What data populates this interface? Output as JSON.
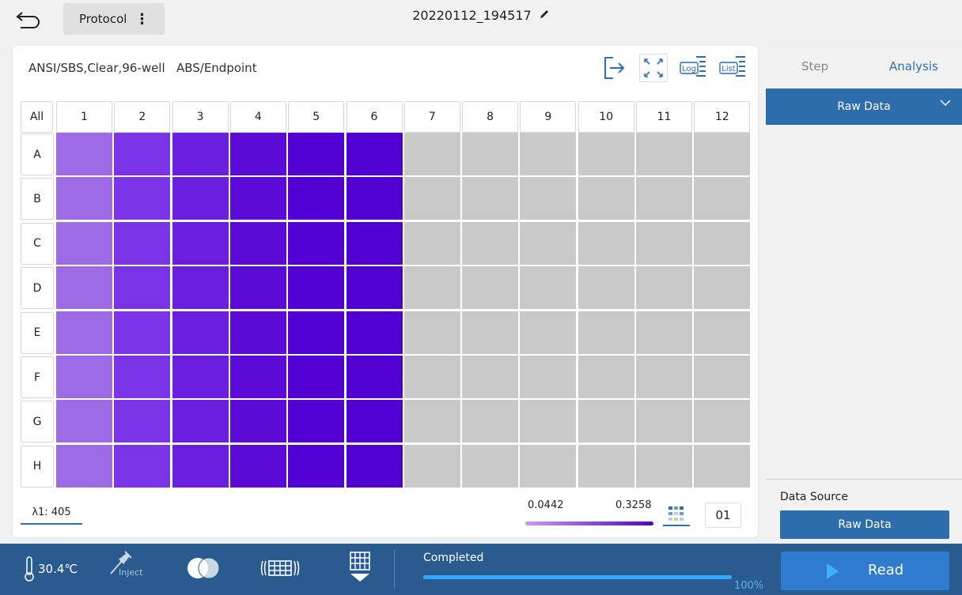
{
  "top": {
    "protocol_label": "Protocol",
    "title": "20220112_194517"
  },
  "plate": {
    "description": "ANSI/SBS,Clear,96-well   ABS/Endpoint",
    "log_label": "Log",
    "list_label": "List",
    "all_label": "All",
    "columns": [
      "1",
      "2",
      "3",
      "4",
      "5",
      "6",
      "7",
      "8",
      "9",
      "10",
      "11",
      "12"
    ],
    "rows": [
      "A",
      "B",
      "C",
      "D",
      "E",
      "F",
      "G",
      "H"
    ],
    "column_colors": [
      "#9d6be6",
      "#7a33e6",
      "#6a1ee0",
      "#5c0ad8",
      "#5300d4",
      "#5000d0",
      "#c9c9c9",
      "#c9c9c9",
      "#c9c9c9",
      "#c9c9c9",
      "#c9c9c9",
      "#c9c9c9"
    ],
    "wavelength": "λ1: 405",
    "scale_min": "0.0442",
    "scale_max": "0.3258",
    "page": "01"
  },
  "right": {
    "tab_step": "Step",
    "tab_analysis": "Analysis",
    "raw_select": "Raw Data",
    "data_source_label": "Data Source",
    "data_source_value": "Raw Data"
  },
  "bottom": {
    "temperature": "30.4℃",
    "inject_label": "Inject",
    "status": "Completed",
    "progress_pct": "100%",
    "progress_fraction": 1.0,
    "read_label": "Read"
  },
  "colors": {
    "accent": "#2e6dab",
    "bottombar": "#2a5b8f",
    "well_empty": "#c9c9c9"
  }
}
